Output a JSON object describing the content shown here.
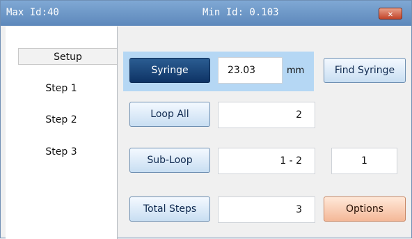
{
  "titlebar": {
    "max_label": "Max Id:40",
    "min_label": "Min Id: 0.103",
    "close_glyph": "✕",
    "close_icon": "close-icon",
    "close_color": "#c2452a"
  },
  "sidebar": {
    "items": [
      {
        "label": "Setup",
        "active": true
      },
      {
        "label": "Step 1",
        "active": false
      },
      {
        "label": "Step 2",
        "active": false
      },
      {
        "label": "Step 3",
        "active": false
      }
    ]
  },
  "syringe": {
    "button_label": "Syringe",
    "value": "23.03",
    "unit": "mm",
    "find_label": "Find Syringe"
  },
  "loop_all": {
    "button_label": "Loop All",
    "value": "2"
  },
  "sub_loop": {
    "button_label": "Sub-Loop",
    "range_value": "1 - 2",
    "count_value": "1"
  },
  "total_steps": {
    "button_label": "Total Steps",
    "value": "3",
    "options_label": "Options"
  },
  "colors": {
    "titlebar": "#5d88bb",
    "selected_button": "#0e3365",
    "options_button": "#f4b898",
    "highlight": "#b5d7f4"
  }
}
